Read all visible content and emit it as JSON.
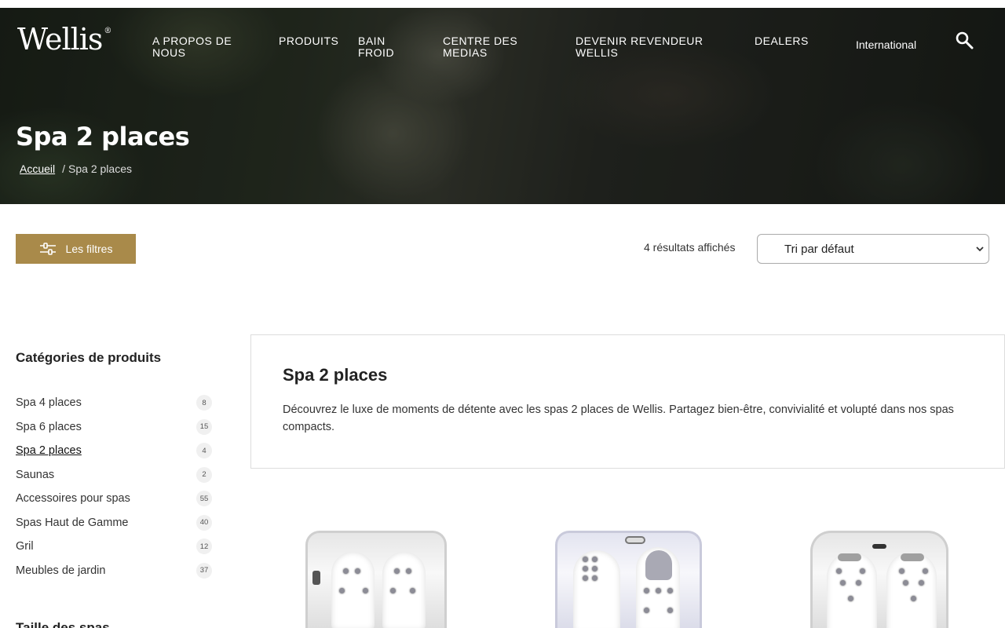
{
  "header": {
    "logo_text": "Wellis",
    "logo_mark": "®",
    "nav": [
      {
        "label_line1": "A PROPOS DE",
        "label_line2": "NOUS"
      },
      {
        "label_line1": "PRODUITS",
        "label_line2": ""
      },
      {
        "label_line1": "BAIN",
        "label_line2": "FROID"
      },
      {
        "label_line1": "CENTRE DES",
        "label_line2": "MEDIAS"
      },
      {
        "label_line1": "DEVENIR REVENDEUR",
        "label_line2": "WELLIS"
      },
      {
        "label_line1": "DEALERS",
        "label_line2": ""
      }
    ],
    "region": "International",
    "search_icon": "search-icon"
  },
  "hero": {
    "title": "Spa 2 places",
    "breadcrumb_home": "Accueil",
    "breadcrumb_sep": "/",
    "breadcrumb_current": "Spa 2 places"
  },
  "toolbar": {
    "filters_label": "Les filtres",
    "filters_icon": "sliders-icon",
    "results_text": "4 résultats affichés",
    "sort_selected": "Tri par défaut"
  },
  "sidebar": {
    "title": "Catégories de produits",
    "categories": [
      {
        "label": "Spa 4 places",
        "count": "8"
      },
      {
        "label": "Spa 6 places",
        "count": "15"
      },
      {
        "label": "Spa 2 places",
        "count": "4",
        "active": true
      },
      {
        "label": "Saunas",
        "count": "2"
      },
      {
        "label": "Accessoires pour spas",
        "count": "55"
      },
      {
        "label": "Spas Haut de Gamme",
        "count": "40"
      },
      {
        "label": "Gril",
        "count": "12"
      },
      {
        "label": "Meubles de jardin",
        "count": "37"
      }
    ],
    "next_title": "Taille des spas"
  },
  "category_description": {
    "title": "Spa 2 places",
    "text": " Découvrez le luxe de moments de détente avec les spas 2 places de Wellis. Partagez bien-être, convivialité et volupté dans nos spas compacts."
  },
  "colors": {
    "accent": "#a98a4a",
    "text": "#222222"
  }
}
